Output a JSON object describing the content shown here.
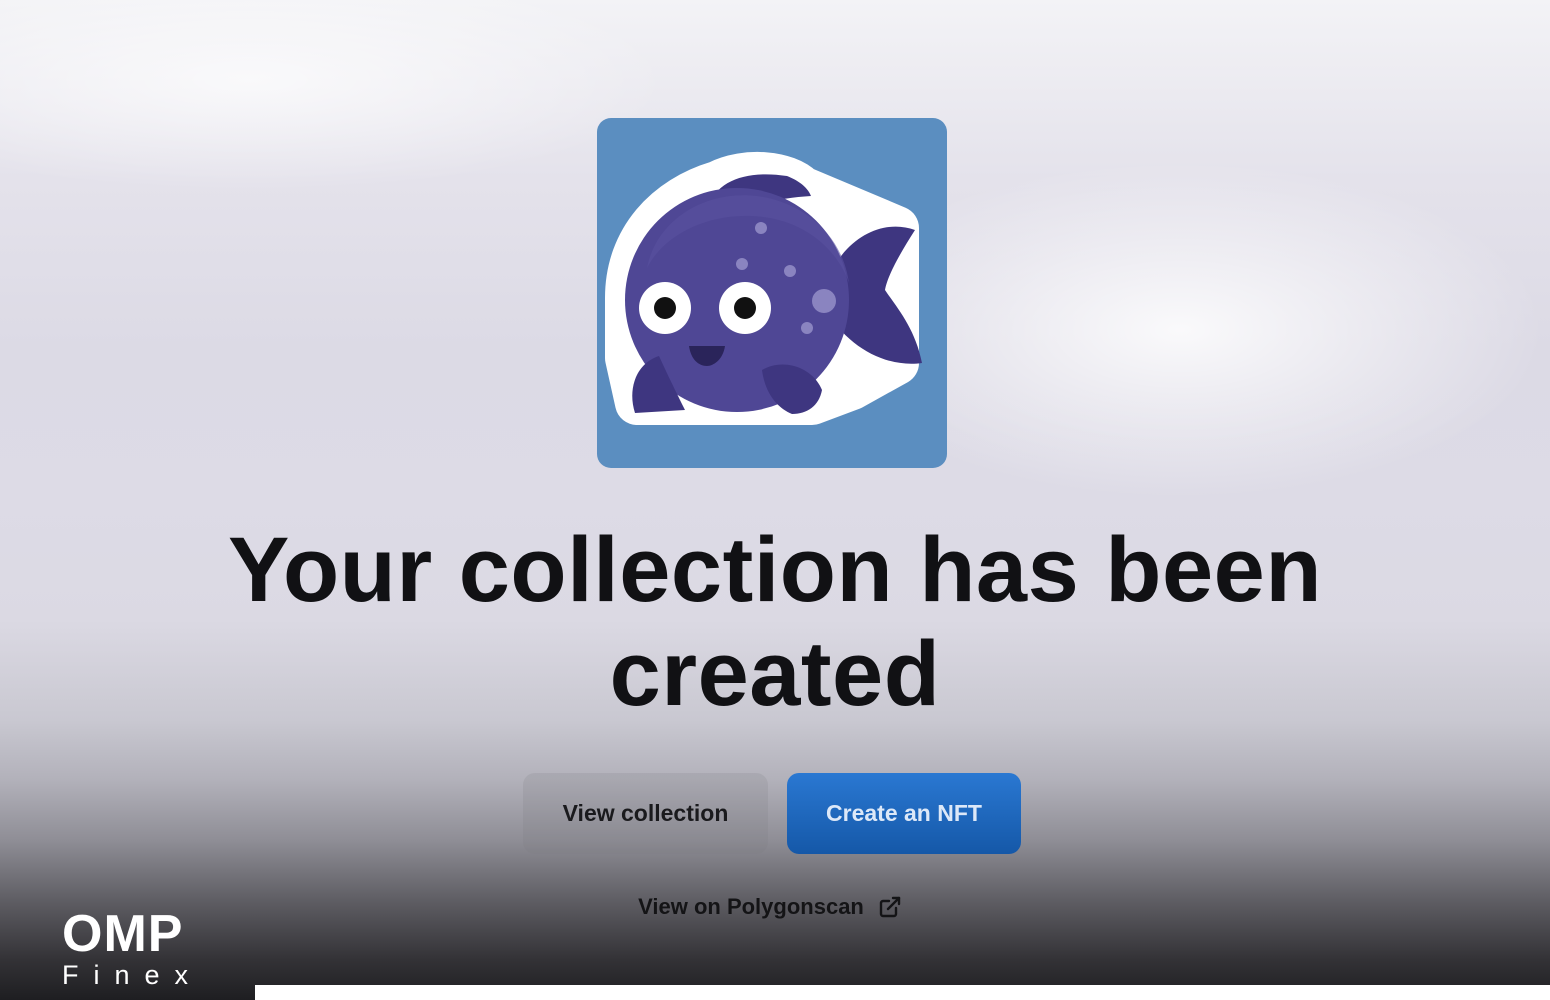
{
  "collection_image": {
    "icon": "fish-sticker-icon",
    "background_color": "#5b8ec0"
  },
  "headline": "Your collection has been created",
  "buttons": {
    "view_collection": "View collection",
    "create_nft": "Create an NFT"
  },
  "explorer_link": {
    "label": "View on Polygonscan",
    "icon": "external-link-icon"
  },
  "watermark": {
    "brand": "OMP",
    "sub": "Finex"
  },
  "colors": {
    "primary": "#1f6bc4",
    "text": "#111114"
  }
}
